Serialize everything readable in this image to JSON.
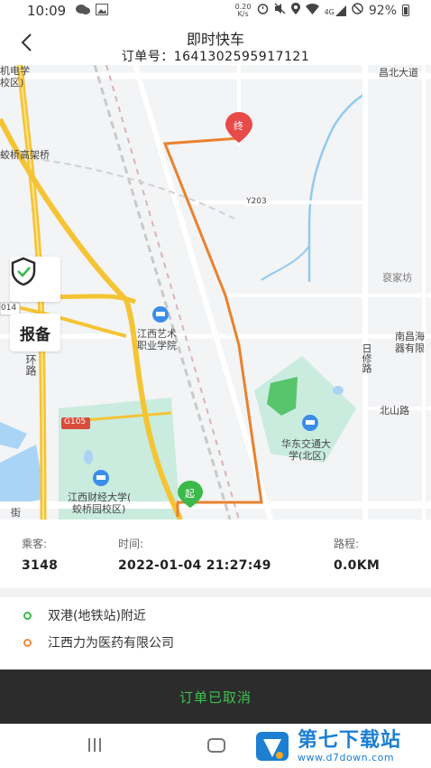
{
  "status_bar": {
    "time": "10:09",
    "net_speed_value": "0.20",
    "net_speed_unit": "K/s",
    "signal_label": "4G",
    "battery": "92%"
  },
  "header": {
    "title": "即时快车",
    "order_no": "订单号：1641302595917121"
  },
  "map": {
    "labels": {
      "top_left_a": "机电学",
      "top_left_b": "校区)",
      "top_road": "昌北大道",
      "qiaojiao": "蛟桥高架桥",
      "y203": "Y203",
      "huanlu": "环路",
      "num014": "014",
      "jiangxi_art_a": "江西艺术",
      "jiangxi_art_b": "职业学院",
      "yuanjiafang": "裒家坊",
      "nanchang_a": "南昌海",
      "nanchang_b": "器有限",
      "rixiu": "日修路",
      "beishan": "北山路",
      "g105": "G105",
      "huadong_a": "华东交通大",
      "huadong_b": "学(北区)",
      "caijing_a": "江西财经大学(",
      "caijing_b": "蛟桥园校区)",
      "jie": "街",
      "end_marker": "终",
      "start_marker": "起"
    },
    "report_label": "报备",
    "route_color": "#e8822e"
  },
  "trip": {
    "passenger_label": "乘客:",
    "passenger_value": "3148",
    "time_label": "时间:",
    "time_value": "2022-01-04 21:27:49",
    "distance_label": "路程:",
    "distance_value": "0.0KM"
  },
  "addresses": {
    "start": "双港(地铁站)附近",
    "end": "江西力为医药有限公司"
  },
  "status": {
    "cancel_text": "订单已取消"
  },
  "watermark": {
    "title": "第七下载站",
    "url": "www.d7down.com"
  },
  "colors": {
    "accent_green": "#3ec24f",
    "route_orange": "#e8822e",
    "marker_red": "#e84a4a",
    "watermark_blue": "#1c7fd2"
  }
}
